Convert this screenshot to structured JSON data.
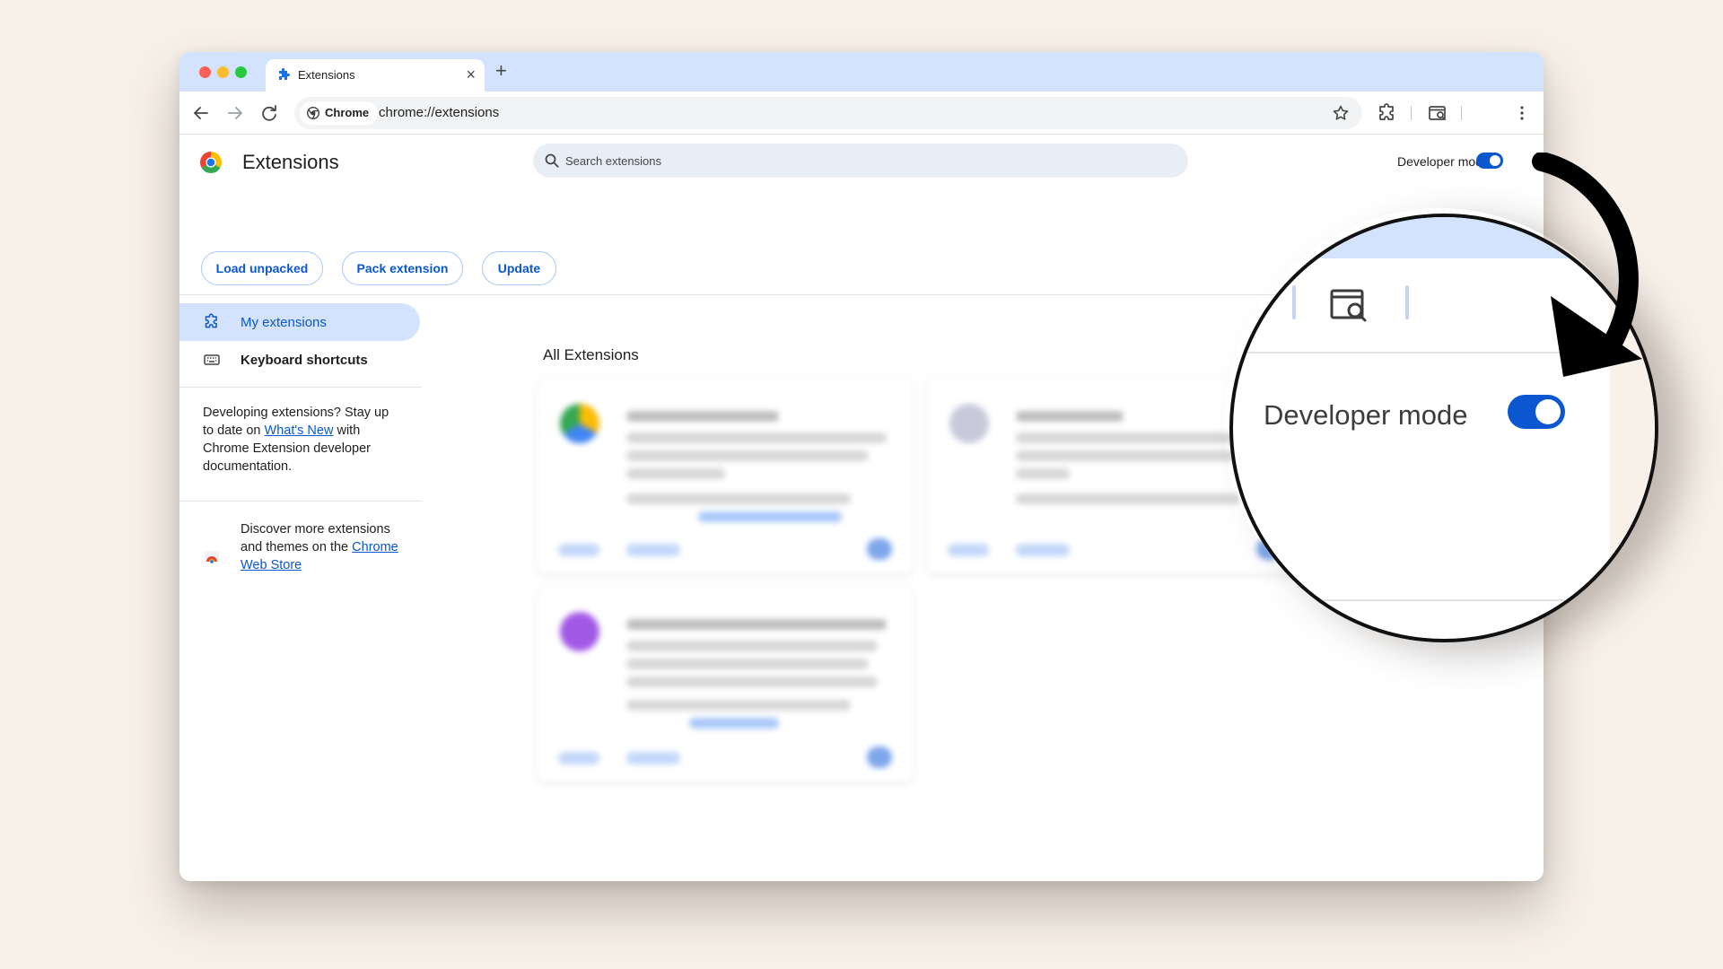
{
  "browser": {
    "tab_title": "Extensions",
    "tab_close": "×",
    "new_tab": "+",
    "chip_label": "Chrome",
    "url": "chrome://extensions"
  },
  "page": {
    "title": "Extensions",
    "search_placeholder": "Search extensions",
    "dev_mode_label": "Developer mode",
    "dev_mode_on": true
  },
  "actions": {
    "load_unpacked": "Load unpacked",
    "pack_extension": "Pack extension",
    "update": "Update"
  },
  "sidebar": {
    "items": [
      {
        "label": "My extensions",
        "icon": "extension-icon",
        "active": true
      },
      {
        "label": "Keyboard shortcuts",
        "icon": "keyboard-icon",
        "active": false
      }
    ],
    "dev_text_pre": "Developing extensions? Stay up to date on ",
    "dev_link": "What's New",
    "dev_text_post": " with Chrome Extension developer documentation.",
    "store_text_pre": "Discover more extensions and themes on the ",
    "store_link": "Chrome Web Store"
  },
  "main": {
    "section_title": "All Extensions"
  },
  "callout": {
    "label": "Developer mode",
    "toggle_on": true
  },
  "colors": {
    "accent": "#0b57d0",
    "tabbar": "#d3e3fd",
    "page_bg": "#f8f1ea"
  }
}
